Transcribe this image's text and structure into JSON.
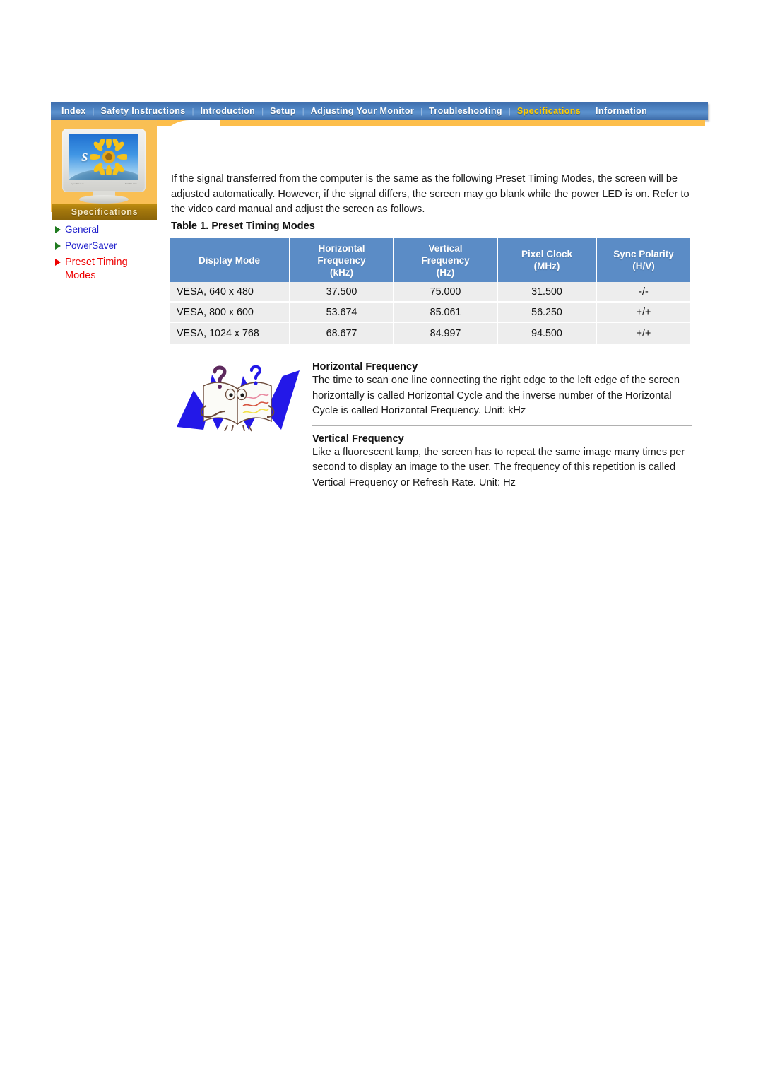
{
  "nav": {
    "separator": "|",
    "items": [
      {
        "label": "Index",
        "active": false
      },
      {
        "label": "Safety Instructions",
        "active": false
      },
      {
        "label": "Introduction",
        "active": false
      },
      {
        "label": "Setup",
        "active": false
      },
      {
        "label": "Adjusting Your Monitor",
        "active": false
      },
      {
        "label": "Troubleshooting",
        "active": false
      },
      {
        "label": "Specifications",
        "active": true
      },
      {
        "label": "Information",
        "active": false
      }
    ]
  },
  "sidebar": {
    "section_title": "Specifications",
    "monitor_screen_letter": "S",
    "monitor_label_left": "SyncMaster",
    "monitor_label_right": "SAMSUNG",
    "links": [
      {
        "label": "General",
        "active": false
      },
      {
        "label": "PowerSaver",
        "active": false
      },
      {
        "label": "Preset Timing Modes",
        "active": true
      }
    ]
  },
  "main": {
    "intro": "If the signal transferred from the computer is the same as the following Preset Timing Modes, the screen will be adjusted automatically. However, if the signal differs, the screen may go blank while the power LED is on. Refer to the video card manual and adjust the screen as follows.",
    "table_caption": "Table 1. Preset Timing Modes",
    "table": {
      "headers": [
        "Display Mode",
        "Horizontal Frequency (kHz)",
        "Vertical Frequency (Hz)",
        "Pixel Clock (MHz)",
        "Sync Polarity (H/V)"
      ],
      "header_lines": [
        [
          "Display Mode"
        ],
        [
          "Horizontal",
          "Frequency",
          "(kHz)"
        ],
        [
          "Vertical",
          "Frequency",
          "(Hz)"
        ],
        [
          "Pixel Clock",
          "(MHz)"
        ],
        [
          "Sync Polarity",
          "(H/V)"
        ]
      ],
      "rows": [
        {
          "mode": "VESA, 640 x 480",
          "hfreq": "37.500",
          "vfreq": "75.000",
          "pclock": "31.500",
          "sync": "-/-"
        },
        {
          "mode": "VESA, 800 x 600",
          "hfreq": "53.674",
          "vfreq": "85.061",
          "pclock": "56.250",
          "sync": "+/+"
        },
        {
          "mode": "VESA, 1024 x 768",
          "hfreq": "68.677",
          "vfreq": "84.997",
          "pclock": "94.500",
          "sync": "+/+"
        }
      ]
    },
    "horizontal_frequency": {
      "title": "Horizontal Frequency",
      "body": "The time to scan one line connecting the right edge to the left edge of the screen horizontally is called Horizontal Cycle and the inverse number of the Horizontal Cycle is called Horizontal Frequency. Unit: kHz"
    },
    "vertical_frequency": {
      "title": "Vertical Frequency",
      "body": "Like a fluorescent lamp, the screen has to repeat the same image many times per second to display an image to the user. The frequency of this repetition is called Vertical Frequency or Refresh Rate. Unit: Hz"
    }
  },
  "colors": {
    "nav_blue": "#4f85c4",
    "nav_active_text": "#ffcc00",
    "sidebar_orange": "#f9bf54",
    "spec_bar_gold": "#a5780c",
    "table_header_blue": "#5b8cc6",
    "table_row_gray": "#ededed",
    "link_blue": "#2020cc",
    "link_active_red": "#ee0000"
  }
}
